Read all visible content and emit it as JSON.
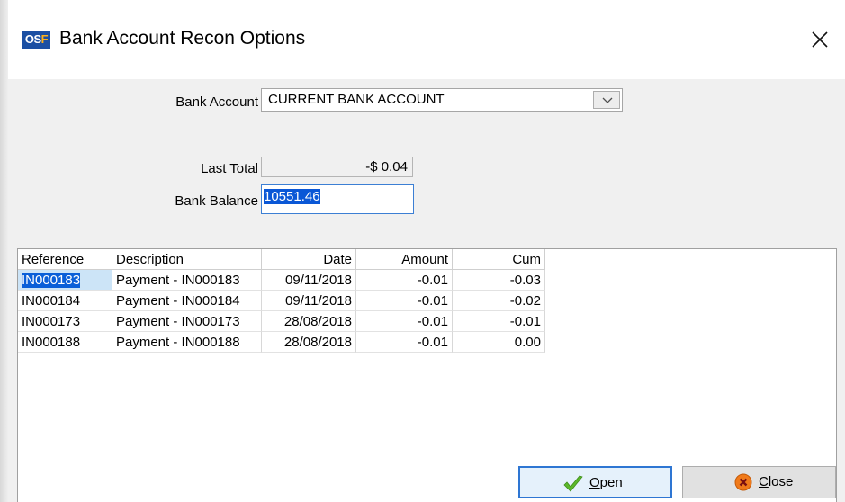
{
  "window": {
    "title": "Bank Account Recon Options",
    "icon_text_a": "OS",
    "icon_text_b": "F"
  },
  "form": {
    "bank_account_label": "Bank Account",
    "bank_account_value": "CURRENT BANK ACCOUNT",
    "last_total_label": "Last Total",
    "last_total_value": "-$ 0.04",
    "bank_balance_label": "Bank Balance",
    "bank_balance_value": "10551.46"
  },
  "grid": {
    "headers": [
      "Reference",
      "Description",
      "Date",
      "Amount",
      "Cum"
    ],
    "rows": [
      [
        "IN000183",
        "Payment - IN000183",
        "09/11/2018",
        "-0.01",
        "-0.03"
      ],
      [
        "IN000184",
        "Payment - IN000184",
        "09/11/2018",
        "-0.01",
        "-0.02"
      ],
      [
        "IN000173",
        "Payment - IN000173",
        "28/08/2018",
        "-0.01",
        "-0.01"
      ],
      [
        "IN000188",
        "Payment - IN000188",
        "28/08/2018",
        "-0.01",
        "0.00"
      ]
    ]
  },
  "buttons": {
    "open_label_first": "O",
    "open_label_rest": "pen",
    "close_label_first": "C",
    "close_label_rest": "lose"
  },
  "icons": {
    "close": "close-x-icon",
    "dropdown": "chevron-down-icon",
    "open": "checkmark-icon",
    "close_btn": "close-circle-icon"
  },
  "colors": {
    "selection": "#0a5fd8",
    "focus_border": "#2e76d3",
    "icon_blue": "#1b4fa3",
    "check_green": "#5cb82a",
    "close_orange": "#f07a1a"
  }
}
